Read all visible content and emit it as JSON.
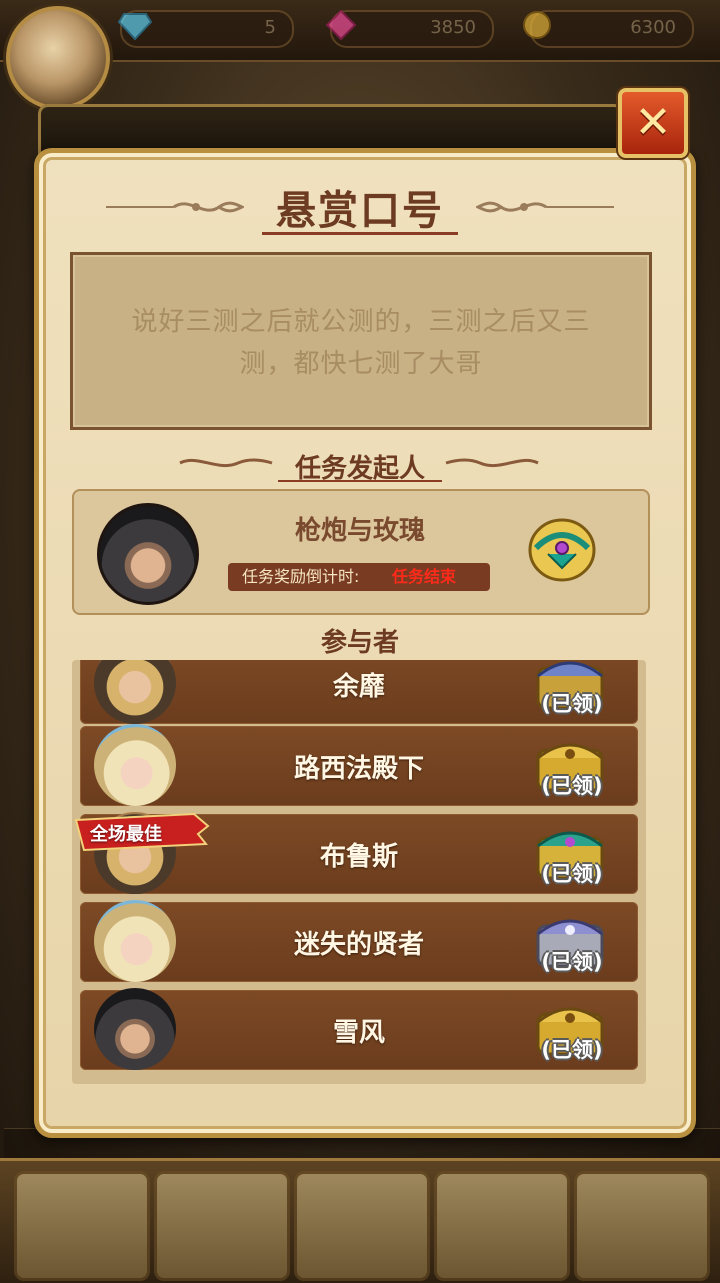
{
  "topbar": {
    "resources": [
      {
        "icon": "diamond-icon",
        "value": "5"
      },
      {
        "icon": "pink-gem-icon",
        "value": "3850"
      },
      {
        "icon": "gold-coin-icon",
        "value": "6300"
      }
    ],
    "marquee": ""
  },
  "modal": {
    "title": "悬赏口号",
    "message": "说好三测之后就公测的，三测之后又三测，都快七测了大哥",
    "initiator_header": "任务发起人",
    "initiator": {
      "name": "枪炮与玫瑰",
      "countdown_label": "任务奖励倒计时:",
      "countdown_value": "任务结束"
    },
    "participants_header": "参与者",
    "participants": [
      {
        "name": "余靡",
        "status": "(已领)",
        "chest": "blue-gold",
        "portrait": "c"
      },
      {
        "name": "路西法殿下",
        "status": "(已领)",
        "chest": "gold",
        "portrait": "b"
      },
      {
        "name": "布鲁斯",
        "status": "(已领)",
        "chest": "teal-gold",
        "portrait": "c",
        "badge": "全场最佳"
      },
      {
        "name": "迷失的贤者",
        "status": "(已领)",
        "chest": "silver",
        "portrait": "b"
      },
      {
        "name": "雪风",
        "status": "(已领)",
        "chest": "gold",
        "portrait": "a"
      }
    ]
  },
  "colors": {
    "title": "#6d3a22",
    "row_bg": "#7d4a25",
    "countdown_value": "#ff2a1a",
    "close_button": "#c8401b"
  }
}
